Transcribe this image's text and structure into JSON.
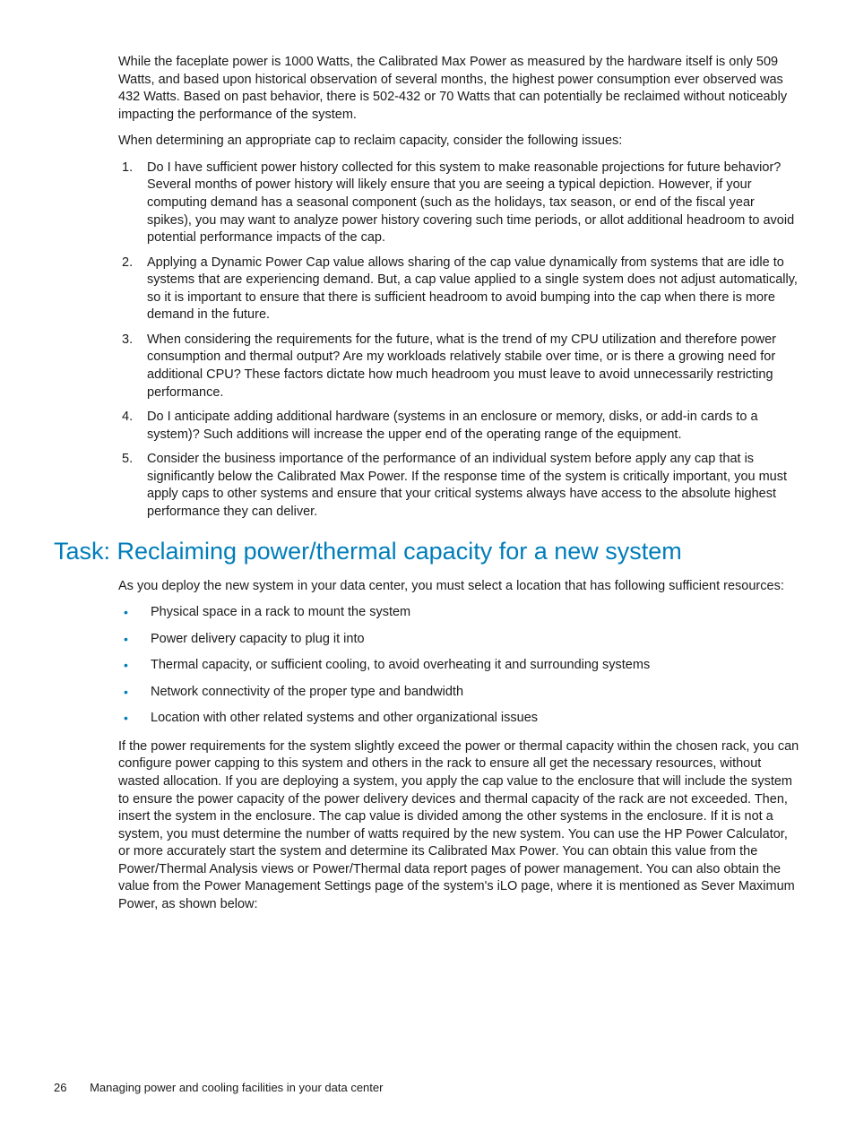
{
  "intro": {
    "para1": "While the faceplate power is 1000 Watts, the Calibrated Max Power as measured by the hardware itself is only 509 Watts, and based upon historical observation of several months, the highest power consumption ever observed was 432 Watts. Based on past behavior, there is 502-432 or 70 Watts that can potentially be reclaimed without noticeably impacting the performance of the system.",
    "para2": "When determining an appropriate cap to reclaim capacity, consider the following issues:"
  },
  "numbered": [
    "Do I have sufficient power history collected for this system to make reasonable projections for future behavior? Several months of power history will likely ensure that you are seeing a typical depiction. However, if your computing demand has a seasonal component (such as the holidays, tax season, or end of the fiscal year spikes), you may want to analyze power history covering such time periods, or allot additional headroom to avoid potential performance impacts of the cap.",
    "Applying a Dynamic Power Cap value allows sharing of the cap value dynamically from systems that are idle to systems that are experiencing demand. But, a cap value applied to a single system does not adjust automatically, so it is important to ensure that there is sufficient headroom to avoid bumping into the cap when there is more demand in the future.",
    "When considering the requirements for the future, what is the trend of my CPU utilization and therefore power consumption and thermal output? Are my workloads relatively stabile over time, or is there a growing need for additional CPU? These factors dictate how much headroom you must leave to avoid unnecessarily restricting performance.",
    "Do I anticipate adding additional hardware (systems in an enclosure or memory, disks, or add-in cards to a system)? Such additions will increase the upper end of the operating range of the equipment.",
    "Consider the business importance of the performance of an individual system before apply any cap that is significantly below the Calibrated Max Power. If the response time of the system is critically important, you must apply caps to other systems and ensure that your critical systems always have access to the absolute highest performance they can deliver."
  ],
  "heading": "Task: Reclaiming power/thermal capacity for a new system",
  "task": {
    "intro": "As you deploy the new system in your data center, you must select a location that has following sufficient resources:",
    "bullets": [
      "Physical space in a rack to mount the system",
      "Power delivery capacity to plug it into",
      "Thermal capacity, or sufficient cooling, to avoid overheating it and surrounding systems",
      "Network connectivity of the proper type and bandwidth",
      "Location with other related systems and other organizational issues"
    ],
    "closing": "If the power requirements for the system slightly exceed the power or thermal capacity within the chosen rack, you can configure power capping to this system and others in the rack to ensure all get the necessary resources, without wasted allocation. If you are deploying a system, you apply the cap value to the enclosure that will include the system to ensure the power capacity of the power delivery devices and thermal capacity of the rack are not exceeded. Then, insert the system in the enclosure. The cap value is divided among the other systems in the enclosure. If it is not a system, you must determine the number of watts required by the new system. You can use the HP Power Calculator, or more accurately start the system and determine its Calibrated Max Power. You can obtain this value from the Power/Thermal Analysis views or Power/Thermal data report pages of power management. You can also obtain the value from the Power Management Settings page of the system's iLO page, where it is mentioned as Sever Maximum Power, as shown below:"
  },
  "footer": {
    "pageNumber": "26",
    "chapterTitle": "Managing power and cooling facilities in your data center"
  }
}
